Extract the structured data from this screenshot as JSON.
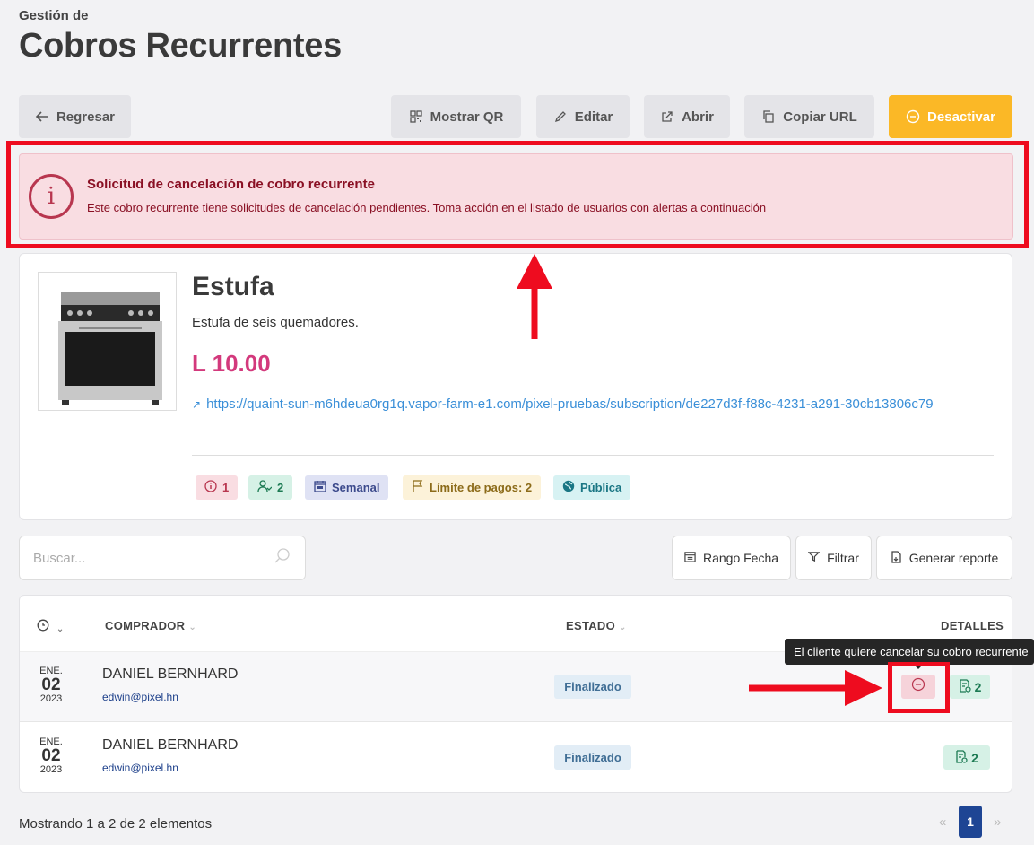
{
  "header": {
    "subtitle": "Gestión de",
    "title": "Cobros Recurrentes"
  },
  "toolbar": {
    "back_label": "Regresar",
    "qr_label": "Mostrar QR",
    "edit_label": "Editar",
    "open_label": "Abrir",
    "copy_label": "Copiar URL",
    "deactivate_label": "Desactivar"
  },
  "alert": {
    "title": "Solicitud de cancelación de cobro recurrente",
    "text": "Este cobro recurrente tiene solicitudes de cancelación pendientes. Toma acción en el listado de usuarios con alertas a continuación"
  },
  "product": {
    "name": "Estufa",
    "description": "Estufa de seis quemadores.",
    "price": "L 10.00",
    "url": "https://quaint-sun-m6hdeua0rg1q.vapor-farm-e1.com/pixel-pruebas/subscription/de227d3f-f88c-4231-a291-30cb13806c79",
    "badges": {
      "alerts": "1",
      "users": "2",
      "frequency": "Semanal",
      "limit": "Límite de pagos: 2",
      "visibility": "Pública"
    }
  },
  "search": {
    "placeholder": "Buscar..."
  },
  "filters": {
    "date_range": "Rango Fecha",
    "filter": "Filtrar",
    "report": "Generar reporte"
  },
  "table": {
    "headers": {
      "buyer": "COMPRADOR",
      "status": "ESTADO",
      "details": "DETALLES"
    },
    "rows": [
      {
        "month": "ENE.",
        "day": "02",
        "year": "2023",
        "buyer": "DANIEL BERNHARD",
        "email": "edwin@pixel.hn",
        "status": "Finalizado",
        "details_count": "2"
      },
      {
        "month": "ENE.",
        "day": "02",
        "year": "2023",
        "buyer": "DANIEL BERNHARD",
        "email": "edwin@pixel.hn",
        "status": "Finalizado",
        "details_count": "2"
      }
    ]
  },
  "tooltip": {
    "text": "El cliente quiere cancelar su cobro recurrente"
  },
  "footer": {
    "summary": "Mostrando 1 a 2 de 2 elementos",
    "prev": "«",
    "current_page": "1",
    "next": "»"
  },
  "colors": {
    "accent": "#fbb826",
    "alert_bg": "#f9dde2",
    "price": "#d3397c",
    "annotation_red": "#ee0c1f",
    "pagination": "#1e4594"
  }
}
